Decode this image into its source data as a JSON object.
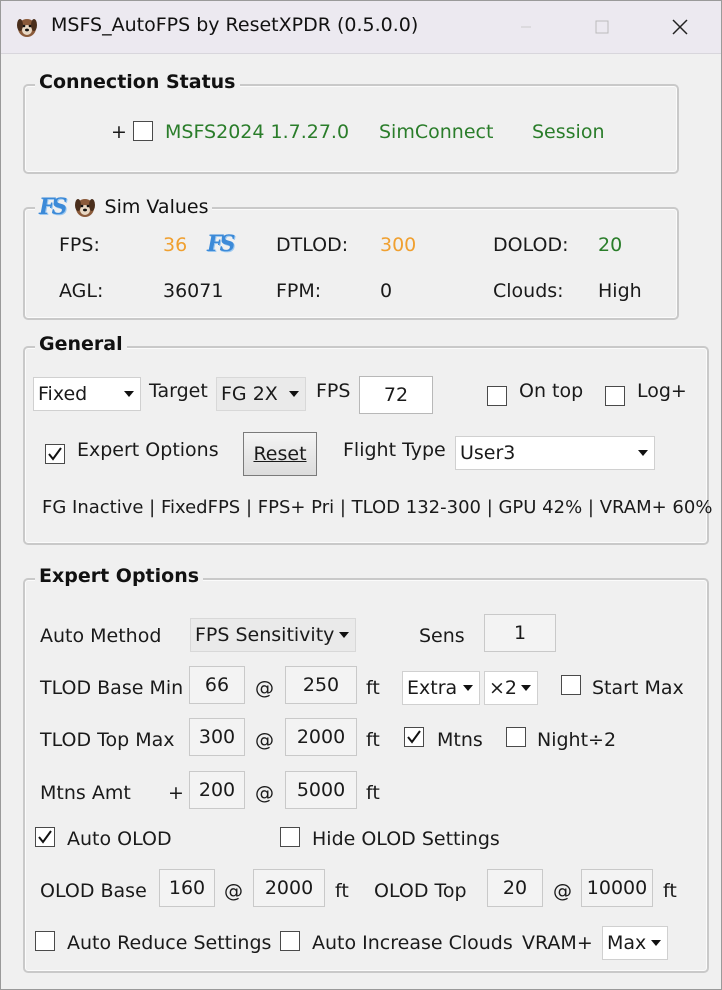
{
  "window": {
    "title": "MSFS_AutoFPS by ResetXPDR (0.5.0.0)",
    "icons": {
      "app": "dog-avatar-icon",
      "minimize": "minimize-icon",
      "maximize": "maximize-icon",
      "close": "close-icon"
    }
  },
  "connection": {
    "legend": "Connection Status",
    "prefix": "+",
    "sim_label": "MSFS2024 1.7.27.0",
    "simconnect_label": "SimConnect",
    "session_label": "Session",
    "status_color": "#2a7d2a"
  },
  "sim_values": {
    "legend": "Sim Values",
    "fps_label": "FPS:",
    "fps_value": "36",
    "dtlod_label": "DTLOD:",
    "dtlod_value": "300",
    "dolod_label": "DOLOD:",
    "dolod_value": "20",
    "agl_label": "AGL:",
    "agl_value": "36071",
    "fpm_label": "FPM:",
    "fpm_value": "0",
    "clouds_label": "Clouds:",
    "clouds_value": "High",
    "fs_icon_text": "FS",
    "orange": "#f0a030",
    "green": "#2a7d2a"
  },
  "general": {
    "legend": "General",
    "mode_value": "Fixed",
    "target_label": "Target",
    "target_value": "FG 2X",
    "fps_label": "FPS",
    "fps_value": "72",
    "on_top_label": "On top",
    "log_label": "Log+",
    "expert_label": "Expert Options",
    "reset_label": "Reset",
    "flight_type_label": "Flight Type",
    "flight_type_value": "User3",
    "status_text": "FG Inactive | FixedFPS | FPS+ Pri | TLOD 132-300 | GPU 42% | VRAM+ 60%"
  },
  "expert": {
    "legend": "Expert Options",
    "auto_method_label": "Auto Method",
    "auto_method_value": "FPS Sensitivity",
    "sens_label": "Sens",
    "sens_value": "1",
    "tlod_base_label": "TLOD Base Min",
    "tlod_base_value": "66",
    "tlod_base_alt": "250",
    "at": "@",
    "ft": "ft",
    "extra_value": "Extra",
    "mult_value": "×2",
    "start_max_label": "Start Max",
    "tlod_top_label": "TLOD Top Max",
    "tlod_top_value": "300",
    "tlod_top_alt": "2000",
    "mtns_label": "Mtns",
    "night_label": "Night÷2",
    "mtns_amt_label": "Mtns Amt",
    "plus": "+",
    "mtns_amt_value": "200",
    "mtns_amt_alt": "5000",
    "auto_olod_label": "Auto OLOD",
    "hide_olod_label": "Hide OLOD Settings",
    "olod_base_label": "OLOD Base",
    "olod_base_value": "160",
    "olod_base_alt": "2000",
    "olod_top_label": "OLOD Top",
    "olod_top_value": "20",
    "olod_top_alt": "10000",
    "auto_reduce_label": "Auto Reduce Settings",
    "auto_increase_label": "Auto Increase Clouds",
    "vram_label": "VRAM+",
    "vram_value": "Max"
  }
}
